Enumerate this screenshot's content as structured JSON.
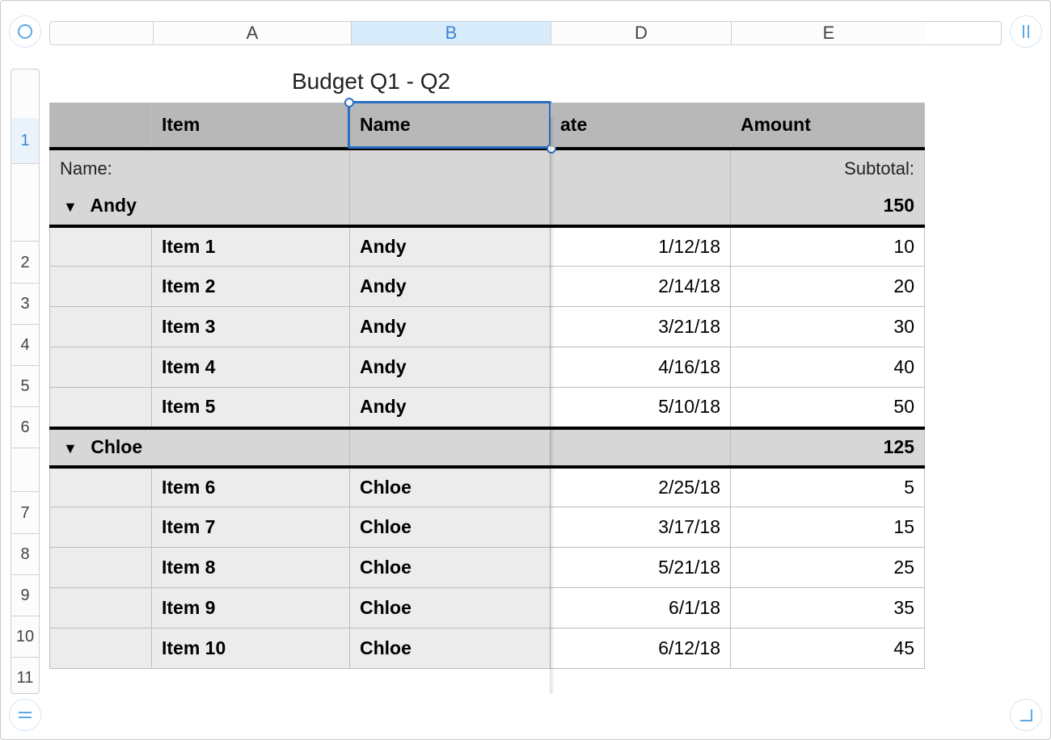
{
  "columns": {
    "A": "A",
    "B": "B",
    "D": "D",
    "E": "E"
  },
  "row_labels": [
    "1",
    "2",
    "3",
    "4",
    "5",
    "6",
    "7",
    "8",
    "9",
    "10",
    "11"
  ],
  "title": "Budget Q1 - Q2",
  "headers": {
    "item": "Item",
    "name": "Name",
    "date_fragment": "ate",
    "amount": "Amount"
  },
  "group_label": {
    "name": "Name:",
    "subtotal": "Subtotal:"
  },
  "groups": [
    {
      "name": "Andy",
      "subtotal": "150",
      "rows": [
        {
          "item": "Item 1",
          "name": "Andy",
          "date": "1/12/18",
          "amount": "10"
        },
        {
          "item": "Item 2",
          "name": "Andy",
          "date": "2/14/18",
          "amount": "20"
        },
        {
          "item": "Item 3",
          "name": "Andy",
          "date": "3/21/18",
          "amount": "30"
        },
        {
          "item": "Item 4",
          "name": "Andy",
          "date": "4/16/18",
          "amount": "40"
        },
        {
          "item": "Item 5",
          "name": "Andy",
          "date": "5/10/18",
          "amount": "50"
        }
      ]
    },
    {
      "name": "Chloe",
      "subtotal": "125",
      "rows": [
        {
          "item": "Item 6",
          "name": "Chloe",
          "date": "2/25/18",
          "amount": "5"
        },
        {
          "item": "Item 7",
          "name": "Chloe",
          "date": "3/17/18",
          "amount": "15"
        },
        {
          "item": "Item 8",
          "name": "Chloe",
          "date": "5/21/18",
          "amount": "25"
        },
        {
          "item": "Item 9",
          "name": "Chloe",
          "date": "6/1/18",
          "amount": "35"
        },
        {
          "item": "Item 10",
          "name": "Chloe",
          "date": "6/12/18",
          "amount": "45"
        }
      ]
    }
  ],
  "selected_column": "B",
  "selected_row": "1"
}
